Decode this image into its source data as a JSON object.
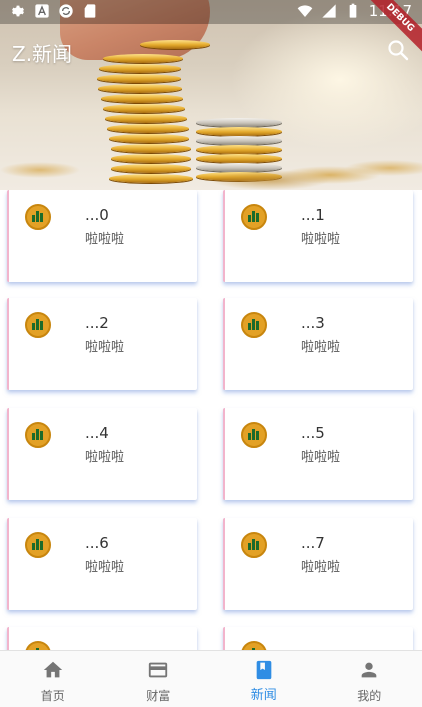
{
  "status_bar": {
    "time": "11:17"
  },
  "debug_banner": "DEBUG",
  "app_bar": {
    "title": "Z.新闻",
    "search_icon": "search-icon"
  },
  "cards": [
    {
      "title": "...0",
      "subtitle": "啦啦啦"
    },
    {
      "title": "...1",
      "subtitle": "啦啦啦"
    },
    {
      "title": "...2",
      "subtitle": "啦啦啦"
    },
    {
      "title": "...3",
      "subtitle": "啦啦啦"
    },
    {
      "title": "...4",
      "subtitle": "啦啦啦"
    },
    {
      "title": "...5",
      "subtitle": "啦啦啦"
    },
    {
      "title": "...6",
      "subtitle": "啦啦啦"
    },
    {
      "title": "...7",
      "subtitle": "啦啦啦"
    },
    {
      "title": "",
      "subtitle": ""
    },
    {
      "title": "",
      "subtitle": ""
    }
  ],
  "bottom_nav": {
    "items": [
      {
        "label": "首页",
        "icon": "home-icon"
      },
      {
        "label": "财富",
        "icon": "credit-card-icon"
      },
      {
        "label": "新闻",
        "icon": "book-icon",
        "active": true
      },
      {
        "label": "我的",
        "icon": "person-icon"
      }
    ]
  },
  "colors": {
    "active_accent": "#2f8de4",
    "card_accent": "#f2b4cc",
    "card_shadow": "#8caae6",
    "avatar_bg": "#e3a126"
  }
}
